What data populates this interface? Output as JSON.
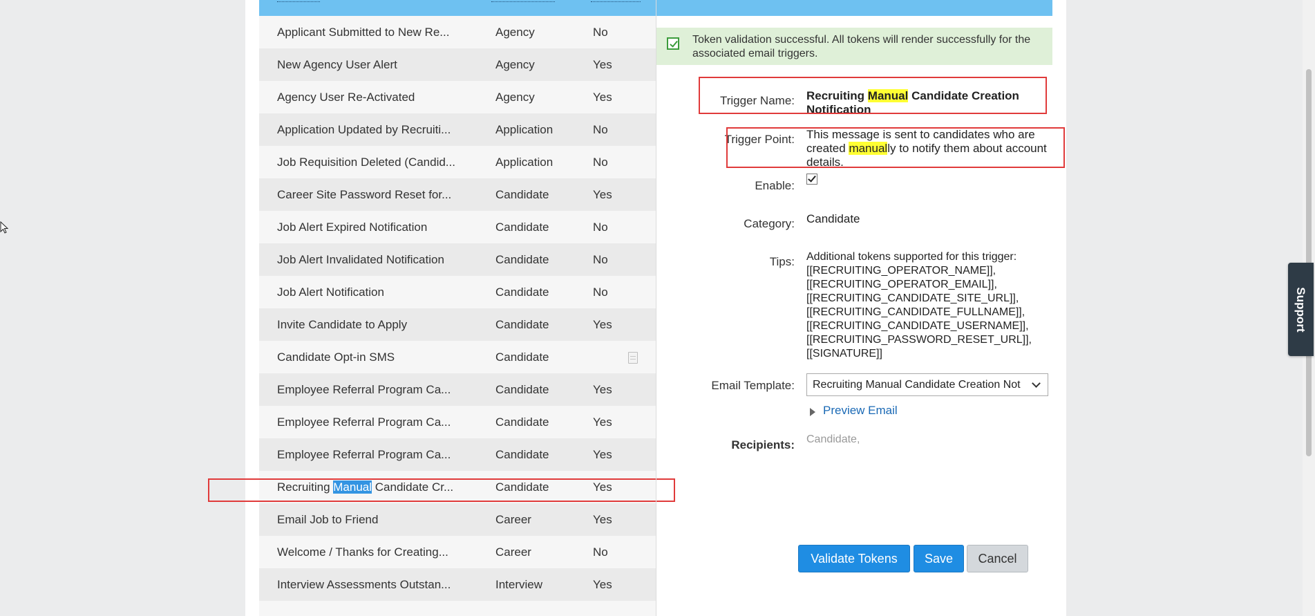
{
  "table": {
    "rows": [
      {
        "name": "Applicant Submitted to New Re...",
        "category": "Agency",
        "enabled": "No"
      },
      {
        "name": "New Agency User Alert",
        "category": "Agency",
        "enabled": "Yes"
      },
      {
        "name": "Agency User Re-Activated",
        "category": "Agency",
        "enabled": "Yes"
      },
      {
        "name": "Application Updated by Recruiti...",
        "category": "Application",
        "enabled": "No"
      },
      {
        "name": "Job Requisition Deleted (Candid...",
        "category": "Application",
        "enabled": "No"
      },
      {
        "name": "Career Site Password Reset for...",
        "category": "Candidate",
        "enabled": "Yes"
      },
      {
        "name": "Job Alert Expired Notification",
        "category": "Candidate",
        "enabled": "No"
      },
      {
        "name": "Job Alert Invalidated Notification",
        "category": "Candidate",
        "enabled": "No"
      },
      {
        "name": "Job Alert Notification",
        "category": "Candidate",
        "enabled": "No"
      },
      {
        "name": "Invite Candidate to Apply",
        "category": "Candidate",
        "enabled": "Yes"
      },
      {
        "name": "Candidate Opt-in SMS",
        "category": "Candidate",
        "enabled": ""
      },
      {
        "name": "Employee Referral Program Ca...",
        "category": "Candidate",
        "enabled": "Yes"
      },
      {
        "name": "Employee Referral Program Ca...",
        "category": "Candidate",
        "enabled": "Yes"
      },
      {
        "name": "Employee Referral Program Ca...",
        "category": "Candidate",
        "enabled": "Yes"
      },
      {
        "name_prefix": "Recruiting ",
        "name_highlight": "Manual",
        "name_suffix": " Candidate Cr...",
        "category": "Candidate",
        "enabled": "Yes"
      },
      {
        "name": "Email Job to Friend",
        "category": "Career",
        "enabled": "Yes"
      },
      {
        "name": "Welcome / Thanks for Creating...",
        "category": "Career",
        "enabled": "No"
      },
      {
        "name": "Interview Assessments Outstan...",
        "category": "Interview",
        "enabled": "Yes"
      }
    ]
  },
  "banner": {
    "text": "Token validation successful. All tokens will render successfully for the associated email triggers."
  },
  "detail": {
    "trigger_name_label": "Trigger Name:",
    "trigger_name_prefix": "Recruiting ",
    "trigger_name_highlight": "Manual",
    "trigger_name_suffix": " Candidate Creation Notification",
    "trigger_point_label": "Trigger Point:",
    "trigger_point_prefix": "This message is sent to candidates who are created ",
    "trigger_point_highlight": "manual",
    "trigger_point_suffix": "ly to notify them about account details.",
    "enable_label": "Enable:",
    "category_label": "Category:",
    "category_value": "Candidate",
    "tips_label": "Tips:",
    "tips_lines": [
      "Additional tokens supported for this trigger:",
      "[[RECRUITING_OPERATOR_NAME]],",
      "[[RECRUITING_OPERATOR_EMAIL]],",
      "[[RECRUITING_CANDIDATE_SITE_URL]],",
      "[[RECRUITING_CANDIDATE_FULLNAME]],",
      "[[RECRUITING_CANDIDATE_USERNAME]],",
      "[[RECRUITING_PASSWORD_RESET_URL]],",
      "[[SIGNATURE]]"
    ],
    "email_template_label": "Email Template:",
    "email_template_value": "Recruiting Manual Candidate Creation Not",
    "preview_email": "Preview Email",
    "recipients_label": "Recipients:",
    "recipients_value": "Candidate,"
  },
  "buttons": {
    "validate": "Validate Tokens",
    "save": "Save",
    "cancel": "Cancel"
  },
  "support_label": "Support",
  "colors": {
    "header": "#6ec1f1",
    "banner": "#dff0d8",
    "primary": "#1f8de3",
    "highlight": "#ffff33",
    "selection": "#3394e2",
    "annotation": "#e03a3a"
  }
}
